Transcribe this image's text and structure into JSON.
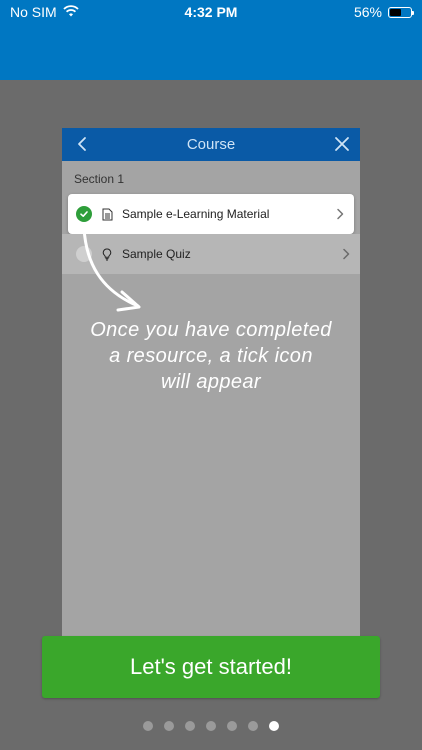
{
  "status_bar": {
    "carrier": "No SIM",
    "time": "4:32 PM",
    "battery_percent": "56%",
    "battery_level": 0.56,
    "wifi_icon": "wifi-icon",
    "battery_icon": "battery-icon"
  },
  "course_preview": {
    "title": "Course",
    "back_icon": "chevron-left-icon",
    "close_icon": "close-icon",
    "section_label": "Section 1",
    "items": [
      {
        "label": "Sample e-Learning Material",
        "status_icon": "check-circle-icon",
        "type_icon": "document-icon",
        "completed": true
      },
      {
        "label": "Sample Quiz",
        "status_icon": "empty-circle-icon",
        "type_icon": "lightbulb-icon",
        "completed": false
      }
    ]
  },
  "annotation": {
    "text": "Once you have completed\na resource, a tick icon\nwill appear"
  },
  "cta": {
    "label": "Let's get started!"
  },
  "pager": {
    "total": 7,
    "active_index": 6
  },
  "colors": {
    "header_blue": "#0077c2",
    "course_header_blue": "#0a5aa6",
    "overlay_gray": "#6b6b6b",
    "cta_green": "#3aa72b",
    "tick_green": "#2e9e3a"
  }
}
